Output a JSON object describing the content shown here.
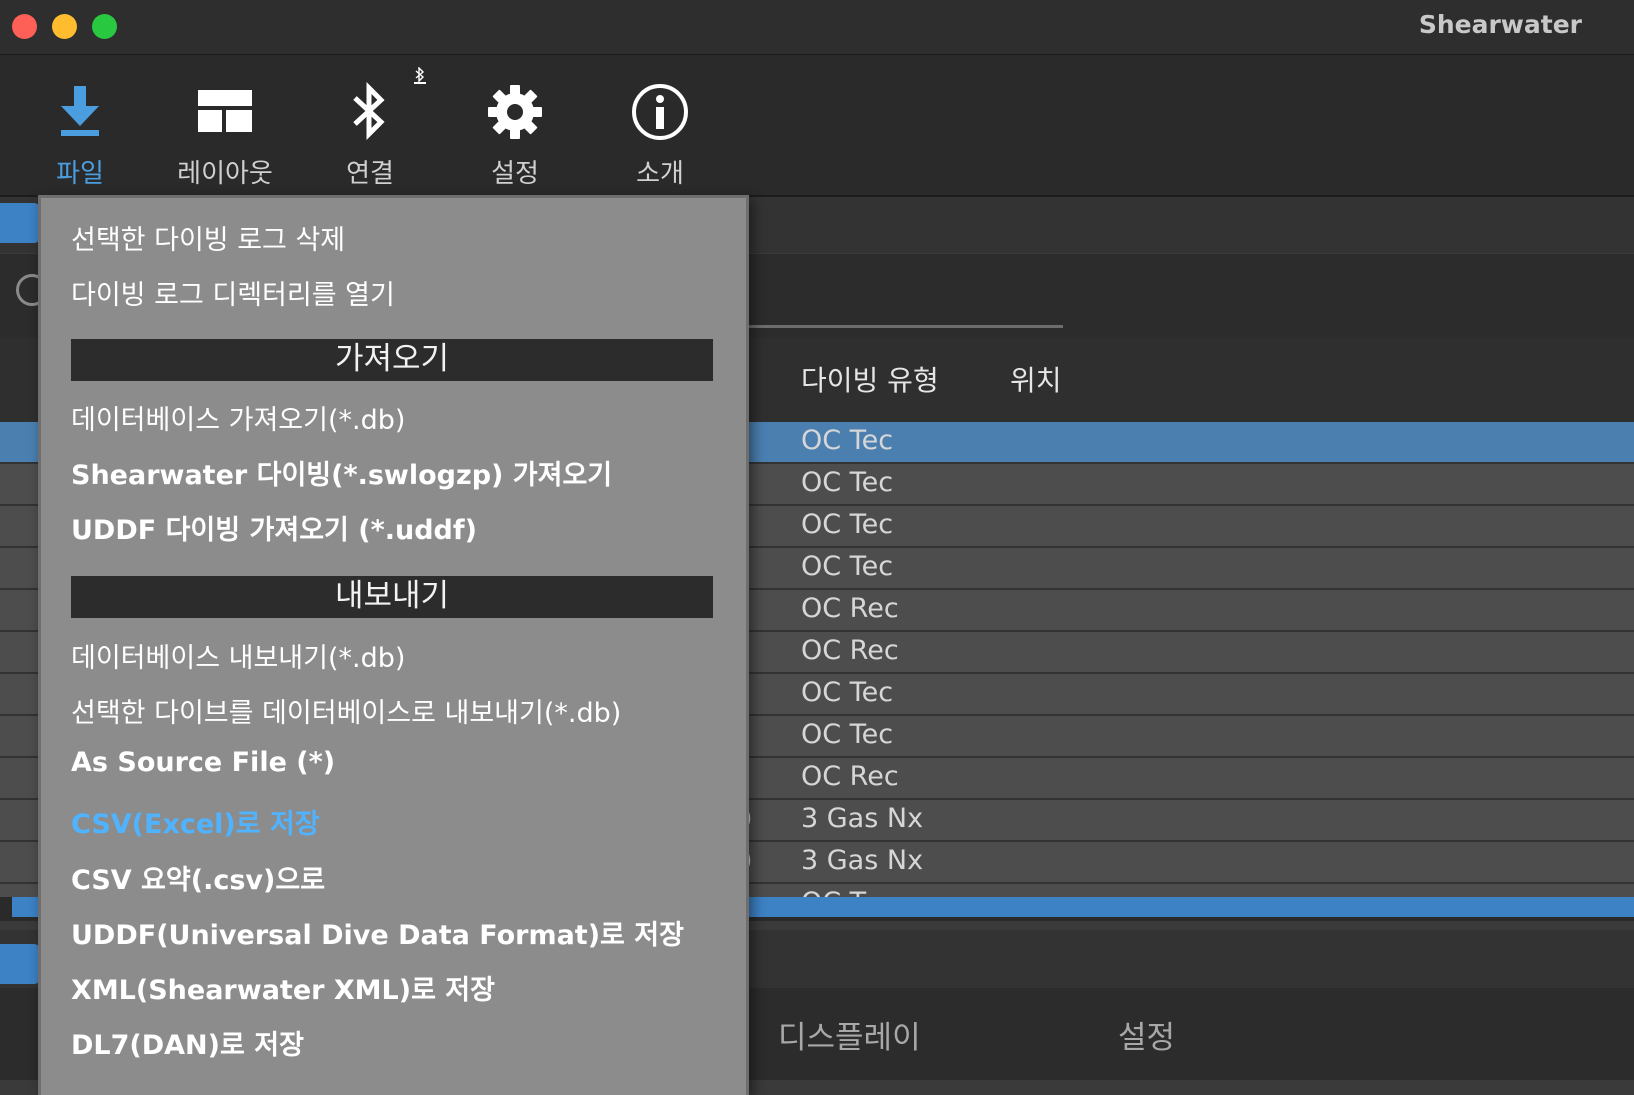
{
  "window": {
    "title": "Shearwater"
  },
  "toolbar": {
    "items": [
      {
        "label": "파일",
        "icon": "download-icon"
      },
      {
        "label": "레이아웃",
        "icon": "layout-icon"
      },
      {
        "label": "연결",
        "icon": "bluetooth-icon"
      },
      {
        "label": "설정",
        "icon": "gear-icon"
      },
      {
        "label": "소개",
        "icon": "info-icon"
      }
    ]
  },
  "colors": {
    "accent": "#4a9ee0",
    "selection": "#4a7fb0",
    "menu_bg": "#8c8c8c",
    "menu_highlight": "#4fb3ff"
  },
  "table": {
    "headers": {
      "dive_type": "다이빙 유형",
      "location": "위치"
    },
    "rows": [
      {
        "dive_type": "OC Tec",
        "prefix": ""
      },
      {
        "dive_type": "OC Tec",
        "prefix": ""
      },
      {
        "dive_type": "OC Tec",
        "prefix": ""
      },
      {
        "dive_type": "OC Tec",
        "prefix": ""
      },
      {
        "dive_type": "OC Rec",
        "prefix": ""
      },
      {
        "dive_type": "OC Rec",
        "prefix": ""
      },
      {
        "dive_type": "OC Tec",
        "prefix": ""
      },
      {
        "dive_type": "OC Tec",
        "prefix": ""
      },
      {
        "dive_type": "OC Rec",
        "prefix": ""
      },
      {
        "dive_type": "3 Gas Nx",
        "prefix": ")"
      },
      {
        "dive_type": "3 Gas Nx",
        "prefix": ")"
      },
      {
        "dive_type": "OC T",
        "prefix": ""
      }
    ]
  },
  "bottom_tabs": {
    "display": "디스플레이",
    "settings": "설정"
  },
  "file_menu": {
    "delete_selected": "선택한 다이빙 로그 삭제",
    "open_log_dir": "다이빙 로그 디렉터리를 열기",
    "import_header": "가져오기",
    "import_db": "데이터베이스 가져오기(*.db)",
    "import_shearwater": "Shearwater 다이빙(*.swlogzp) 가져오기",
    "import_uddf": "UDDF 다이빙 가져오기 (*.uddf)",
    "export_header": "내보내기",
    "export_db": "데이터베이스 내보내기(*.db)",
    "export_selected_db": "선택한 다이브를 데이터베이스로 내보내기(*.db)",
    "as_source": "As Source File (*)",
    "save_csv_excel": "CSV(Excel)로 저장",
    "csv_summary": "CSV 요약(.csv)으로",
    "save_uddf": "UDDF(Universal Dive Data Format)로 저장",
    "save_xml": "XML(Shearwater XML)로 저장",
    "save_dl7": "DL7(DAN)로 저장"
  }
}
